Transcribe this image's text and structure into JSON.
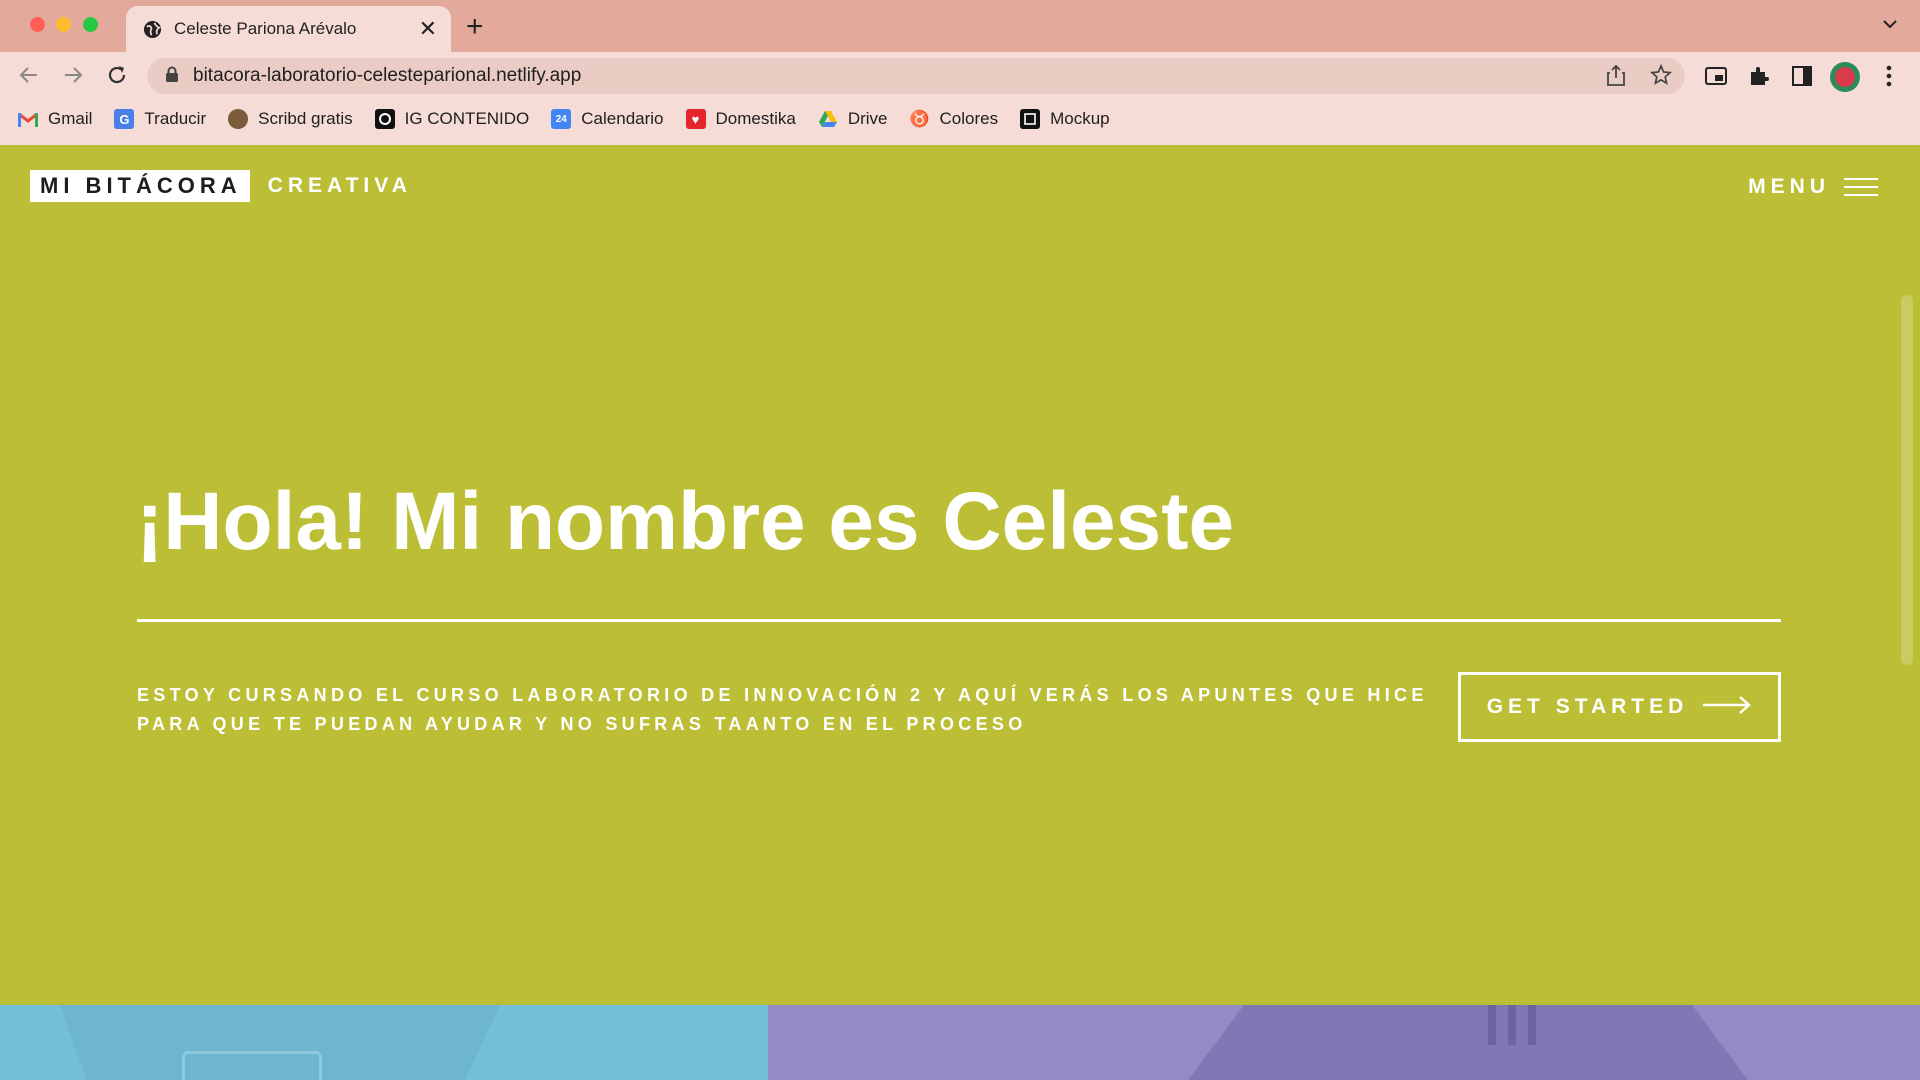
{
  "browser": {
    "tab": {
      "title": "Celeste Pariona Arévalo"
    },
    "url": "bitacora-laboratorio-celesteparional.netlify.app",
    "bookmarks": [
      {
        "label": "Gmail",
        "icon": "gmail-icon"
      },
      {
        "label": "Traducir",
        "icon": "translate-icon"
      },
      {
        "label": "Scribd gratis",
        "icon": "scribd-icon"
      },
      {
        "label": "IG CONTENIDO",
        "icon": "instagram-icon"
      },
      {
        "label": "Calendario",
        "icon": "calendar-icon"
      },
      {
        "label": "Domestika",
        "icon": "domestika-icon"
      },
      {
        "label": "Drive",
        "icon": "drive-icon"
      },
      {
        "label": "Colores",
        "icon": "colors-icon"
      },
      {
        "label": "Mockup",
        "icon": "mockup-icon"
      }
    ]
  },
  "site": {
    "logo_box": "MI BITÁCORA",
    "logo_rest": "CREATIVA",
    "menu_label": "MENU",
    "hero_title": "¡Hola! Mi nombre es Celeste",
    "hero_subtitle": "ESTOY CURSANDO EL CURSO LABORATORIO DE INNOVACIÓN 2 Y AQUÍ VERÁS LOS APUNTES QUE HICE PARA QUE TE PUEDAN AYUDAR Y NO SUFRAS TAANTO EN EL PROCESO",
    "cta_label": "GET STARTED"
  },
  "colors": {
    "hero_background": "#bcbf35",
    "tab_strip": "#e3aa9c",
    "toolbar": "#f5dcd6",
    "panel_left": "#73bfd9",
    "panel_right": "#958bc6"
  }
}
